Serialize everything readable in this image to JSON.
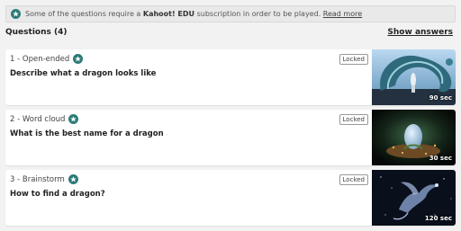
{
  "notice": {
    "text_before": "Some of the questions require a",
    "brand": "Kahoot! EDU",
    "text_after": "subscription in order to be played.",
    "link": "Read more"
  },
  "questions_header": {
    "title": "Questions (4)",
    "show_answers": "Show answers"
  },
  "questions": [
    {
      "type": "1 - Open-ended",
      "title": "Describe what a dragon looks like",
      "locked": "Locked",
      "duration": "90 sec",
      "image_icon": "dragon-sculpture-image"
    },
    {
      "type": "2 - Word cloud",
      "title": "What is the best name for a dragon",
      "locked": "Locked",
      "duration": "30 sec",
      "image_icon": "dragon-egg-image"
    },
    {
      "type": "3 - Brainstorm",
      "title": "How to find a dragon?",
      "locked": "Locked",
      "duration": "120 sec",
      "image_icon": "starry-dragon-image"
    }
  ],
  "colors": {
    "badge": "#2b7a78",
    "page_bg": "#f2f2f2"
  }
}
